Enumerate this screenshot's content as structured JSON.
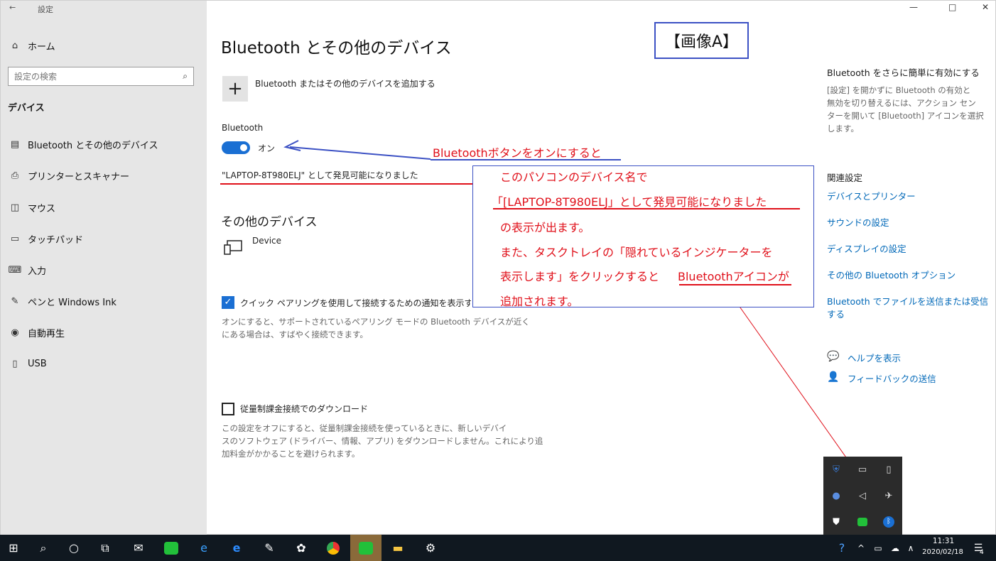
{
  "window": {
    "title": "設定",
    "back": "←",
    "minimize": "—",
    "maximize": "□",
    "close": "✕"
  },
  "sidebar": {
    "home": "ホーム",
    "search_placeholder": "設定の検索",
    "section": "デバイス",
    "items": [
      {
        "label": "Bluetooth とその他のデバイス",
        "icon": "bluetooth-devices-icon"
      },
      {
        "label": "プリンターとスキャナー",
        "icon": "printer-icon"
      },
      {
        "label": "マウス",
        "icon": "mouse-icon"
      },
      {
        "label": "タッチパッド",
        "icon": "touchpad-icon"
      },
      {
        "label": "入力",
        "icon": "keyboard-icon"
      },
      {
        "label": "ペンと Windows Ink",
        "icon": "pen-icon"
      },
      {
        "label": "自動再生",
        "icon": "autoplay-icon"
      },
      {
        "label": "USB",
        "icon": "usb-icon"
      }
    ]
  },
  "main": {
    "title": "Bluetooth とその他のデバイス",
    "add_device": "Bluetooth またはその他のデバイスを追加する",
    "bluetooth_label": "Bluetooth",
    "toggle_state": "オン",
    "discoverable": "\"LAPTOP-8T980ELJ\" として発見可能になりました",
    "other_devices": "その他のデバイス",
    "device_name": "Device",
    "quick_pair": "クイック ペアリングを使用して接続するための通知を表示する",
    "quick_pair_desc_1": "オンにすると、サポートされているペアリング モードの Bluetooth デバイスが近く",
    "quick_pair_desc_2": "にある場合は、すばやく接続できます。",
    "metered": "従量制課金接続でのダウンロード",
    "metered_desc_1": "この設定をオフにすると、従量制課金接続を使っているときに、新しいデバイ",
    "metered_desc_2": "スのソフトウェア (ドライバー、情報、アプリ) をダウンロードしません。これにより追",
    "metered_desc_3": "加料金がかかることを避けられます。"
  },
  "right": {
    "heading": "Bluetooth をさらに簡単に有効にする",
    "desc_1": "[設定] を開かずに Bluetooth の有効と",
    "desc_2": "無効を切り替えるには、アクション セン",
    "desc_3": "ターを開いて [Bluetooth] アイコンを選択",
    "desc_4": "します。",
    "related": "関連設定",
    "links": [
      "デバイスとプリンター",
      "サウンドの設定",
      "ディスプレイの設定",
      "その他の Bluetooth オプション",
      "Bluetooth でファイルを送信または受信",
      "する"
    ],
    "help": "ヘルプを表示",
    "feedback": "フィードバックの送信"
  },
  "annotation": {
    "label_a": "【画像A】",
    "arrow_text": "Bluetoothボタンをオンにすると",
    "callout_1": "このパソコンのデバイス名で",
    "callout_2": "「[LAPTOP-8T980ELJ」として発見可能になりました",
    "callout_3": "の表示が出ます。",
    "callout_4": "また、タスクトレイの「隠れているインジケーターを",
    "callout_5a": "表示します」をクリックすると",
    "callout_5b": "Bluetoothアイコンが",
    "callout_6": "追加されます。",
    "red_color": "#e0101a",
    "blue_color": "#3c51c4"
  },
  "taskbar": {
    "time": "11:31",
    "date": "2020/02/18",
    "notification_count": "4"
  },
  "colors": {
    "accent": "#1a6fd3",
    "link": "#0068b8",
    "taskbar": "#101820"
  }
}
